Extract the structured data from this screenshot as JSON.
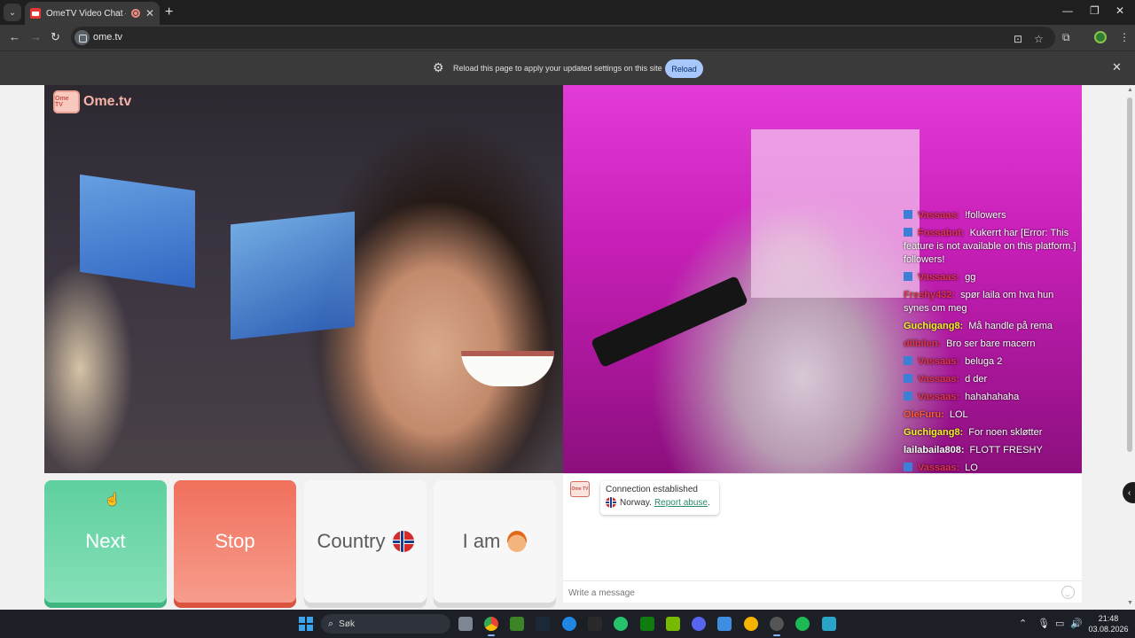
{
  "browser": {
    "tab_title": "OmeTV Video Chat — Ome",
    "url": "ome.tv",
    "infobar_text": "Reload this page to apply your updated settings on this site",
    "infobar_button": "Reload"
  },
  "page": {
    "logo_text": "Ome.tv",
    "logo_icon_text": "Ome TV",
    "buttons": {
      "next": "Next",
      "stop": "Stop",
      "country": "Country",
      "iam": "I am"
    },
    "system_message": {
      "line1": "Connection established",
      "country": "Norway.",
      "report": "Report abuse",
      "report_suffix": "."
    },
    "message_placeholder": "Write a message"
  },
  "stream_chat": [
    {
      "user": "Vassaas:",
      "text": "!followers",
      "color": "#e0334d",
      "badge": true
    },
    {
      "user": "Fossabot:",
      "text": "Kukerrt har [Error: This feature is not available on this platform.] followers!",
      "color": "#e0334d",
      "badge": true
    },
    {
      "user": "Vassaas:",
      "text": "gg",
      "color": "#e0334d",
      "badge": true
    },
    {
      "user": "Freshy432:",
      "text": "spør laila om hva hun synes om meg",
      "color": "#e0334d",
      "badge": false
    },
    {
      "user": "Guchigang8:",
      "text": "Må handle på rema",
      "color": "#f4f02a",
      "badge": false
    },
    {
      "user": "dilbilen:",
      "text": "Bro ser bare macern",
      "color": "#e0334d",
      "badge": false
    },
    {
      "user": "Vassaas:",
      "text": "beluga 2",
      "color": "#e0334d",
      "badge": true
    },
    {
      "user": "Vassaas:",
      "text": "d der",
      "color": "#e0334d",
      "badge": true
    },
    {
      "user": "Vassaas:",
      "text": "hahahahaha",
      "color": "#e0334d",
      "badge": true
    },
    {
      "user": "OleFuru:",
      "text": "LOL",
      "color": "#ff5a3a",
      "badge": false
    },
    {
      "user": "Guchigang8:",
      "text": "For noen skløtter",
      "color": "#f4f02a",
      "badge": false
    },
    {
      "user": "lailabaila808:",
      "text": "FLOTT FRESHY",
      "color": "#ffffff",
      "badge": false
    },
    {
      "user": "Vassaas:",
      "text": "LO",
      "color": "#e0334d",
      "badge": true
    }
  ],
  "taskbar": {
    "search_label": "Søk",
    "time": "21:48",
    "date": "03.08.2026"
  },
  "colors": {
    "next_green": "#5fd0a0",
    "stop_red": "#f0705c",
    "reload_blue": "#a8c7fa"
  }
}
